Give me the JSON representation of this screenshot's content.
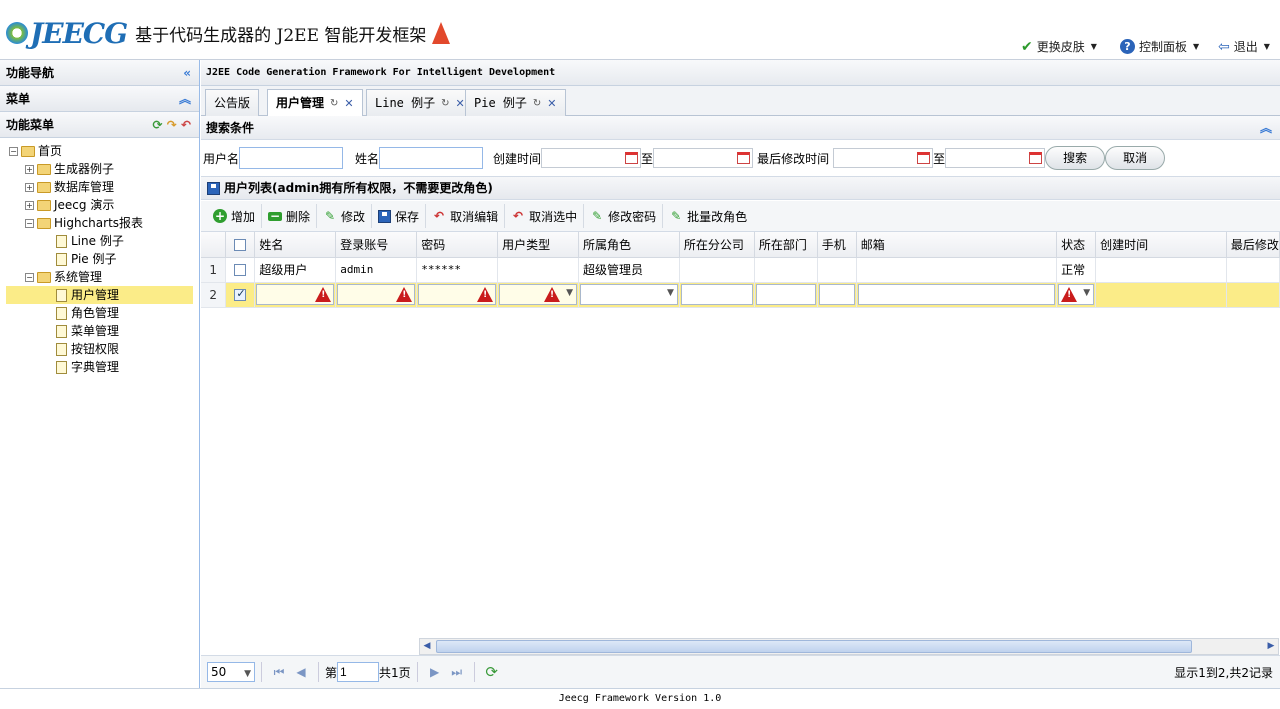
{
  "header": {
    "logo_text": "JEECG",
    "logo_subtitle": "基于代码生成器的 J2EE 智能开发框架",
    "actions": [
      {
        "label": "更换皮肤",
        "icon": "check-icon"
      },
      {
        "label": "控制面板",
        "icon": "help-icon"
      },
      {
        "label": "退出",
        "icon": "logout-icon"
      }
    ]
  },
  "left": {
    "nav_title": "功能导航",
    "menu_title": "菜单",
    "func_title": "功能菜单",
    "tree": [
      "首页",
      "生成器例子",
      "数据库管理",
      "Jeecg 演示",
      "Highcharts报表",
      "Line 例子",
      "Pie 例子",
      "系统管理",
      "用户管理",
      "角色管理",
      "菜单管理",
      "按钮权限",
      "字典管理"
    ]
  },
  "main": {
    "title": "J2EE Code Generation Framework For Intelligent Development",
    "tabs": [
      "公告版",
      "用户管理",
      "Line 例子",
      "Pie 例子"
    ],
    "search": {
      "title": "搜索条件",
      "f_user": "用户名",
      "f_name": "姓名",
      "f_created": "创建时间",
      "to": "至",
      "f_modified": "最后修改时间",
      "to2": "至",
      "search_btn": "搜索",
      "cancel_btn": "取消"
    },
    "list_title": "用户列表(admin拥有所有权限，不需要更改角色)",
    "toolbar": [
      "增加",
      "删除",
      "修改",
      "保存",
      "取消编辑",
      "取消选中",
      "修改密码",
      "批量改角色"
    ],
    "columns": [
      "姓名",
      "登录账号",
      "密码",
      "用户类型",
      "所属角色",
      "所在分公司",
      "所在部门",
      "手机",
      "邮箱",
      "状态",
      "创建时间",
      "最后修改"
    ],
    "rows": [
      {
        "num": "1",
        "name": "超级用户",
        "account": "admin",
        "password": "******",
        "type": "",
        "role": "超级管理员",
        "status": "正常"
      },
      {
        "num": "2"
      }
    ],
    "pager": {
      "page_size": "50",
      "page_label": "第",
      "page_value": "1",
      "total_pages": "共1页",
      "summary": "显示1到2,共2记录"
    }
  },
  "footer": "Jeecg Framework Version 1.0",
  "colors": {
    "accent": "#1f6eb5",
    "selected_row": "#fbec88",
    "warning": "#c91c1c"
  }
}
